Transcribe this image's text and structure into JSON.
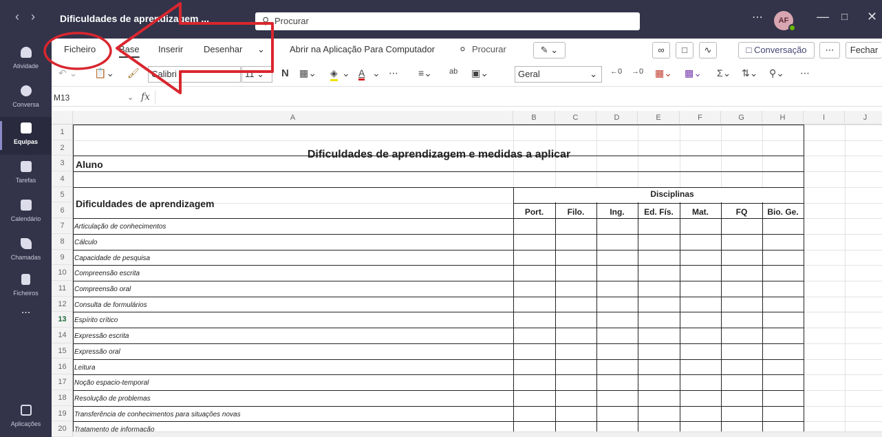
{
  "titlebar": {
    "doc_title": "Dificuldades de aprendizagem ...",
    "search_placeholder": "Procurar",
    "avatar_initials": "AF"
  },
  "rail": [
    {
      "label": "Atividade",
      "icon": "bell-icon"
    },
    {
      "label": "Conversa",
      "icon": "chat-icon"
    },
    {
      "label": "Equipas",
      "icon": "teams-icon"
    },
    {
      "label": "Tarefas",
      "icon": "tasks-icon"
    },
    {
      "label": "Calendário",
      "icon": "calendar-icon"
    },
    {
      "label": "Chamadas",
      "icon": "phone-icon"
    },
    {
      "label": "Ficheiros",
      "icon": "file-icon"
    },
    {
      "label": "...",
      "icon": "more-icon"
    },
    {
      "label": "Aplicações",
      "icon": "apps-icon"
    }
  ],
  "ribbon": {
    "tabs": [
      "Ficheiro",
      "Base",
      "Inserir",
      "Desenhar"
    ],
    "open_desktop": "Abrir na Aplicação Para Computador",
    "search": "Procurar",
    "conversation": "Conversação",
    "close": "Fechar",
    "font": "Calibri",
    "font_size": "11",
    "bold": "N",
    "number_format": "Geral"
  },
  "formula_bar": {
    "name_box": "M13",
    "fx": "fx"
  },
  "sheet": {
    "columns": [
      "A",
      "B",
      "C",
      "D",
      "E",
      "F",
      "G",
      "H",
      "I",
      "J"
    ],
    "rows": [
      "1",
      "2",
      "3",
      "4",
      "5",
      "6",
      "7",
      "8",
      "9",
      "10",
      "11",
      "12",
      "13",
      "14",
      "15",
      "16",
      "17",
      "18",
      "19",
      "20"
    ],
    "selected_row": "13",
    "title": "Dificuldades de aprendizagem e medidas a aplicar",
    "aluno": "Aluno",
    "dificuldades_header": "Dificuldades de aprendizagem",
    "disciplinas": "Disciplinas",
    "subjects": [
      "Port.",
      "Filo.",
      "Ing.",
      "Ed. Fís.",
      "Mat.",
      "FQ",
      "Bio. Ge."
    ],
    "items": [
      "Articulação de conhecimentos",
      "Cálculo",
      "Capacidade de pesquisa",
      "Compreensão escrita",
      "Compreensão oral",
      "Consulta de formulários",
      "Espírito crítico",
      "Expressão escrita",
      "Expressão oral",
      "Leitura",
      "Noção espacio-temporal",
      "Resolução de problemas",
      "Transferência de conhecimentos para situações novas",
      "Tratamento de informação"
    ]
  },
  "colors": {
    "teams_dark": "#33344a",
    "annotation_red": "#d9262e"
  }
}
